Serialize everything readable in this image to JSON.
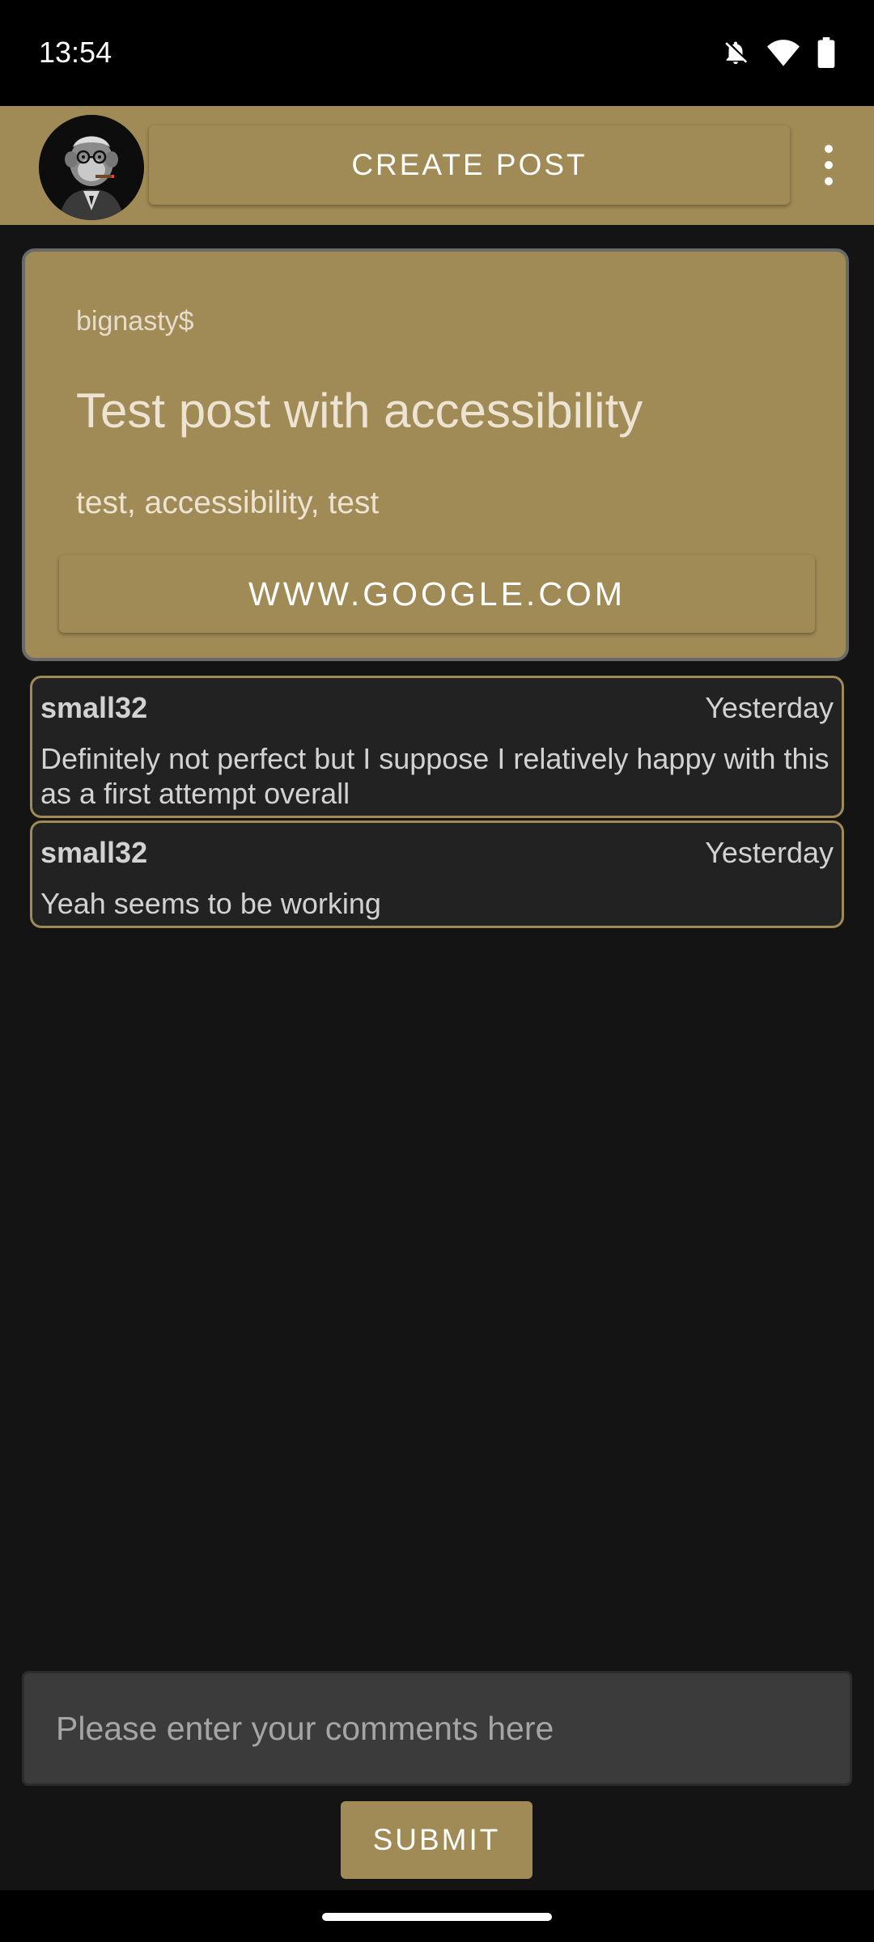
{
  "status_bar": {
    "time": "13:54",
    "icons": [
      "bell-off-icon",
      "wifi-icon",
      "battery-icon"
    ]
  },
  "app_bar": {
    "avatar_icon": "monkey-avatar-icon",
    "create_post_label": "CREATE POST",
    "menu_icon": "more-vert-icon",
    "color": "#a08a55"
  },
  "post": {
    "author": "bignasty$",
    "title": "Test post with accessibility",
    "tags": "test, accessibility, test",
    "link_label": "WWW.GOOGLE.COM"
  },
  "comments": [
    {
      "author": "small32",
      "time": "Yesterday",
      "text": "Definitely not perfect but I suppose I relatively happy with this as a first attempt overall"
    },
    {
      "author": "small32",
      "time": "Yesterday",
      "text": "Yeah seems to be working"
    }
  ],
  "comment_form": {
    "placeholder": "Please enter your comments here",
    "value": "",
    "submit_label": "SUBMIT"
  },
  "colors": {
    "accent": "#a08a55",
    "background": "#141414",
    "comment_bg": "#222222",
    "input_bg": "#3b3b3b"
  }
}
